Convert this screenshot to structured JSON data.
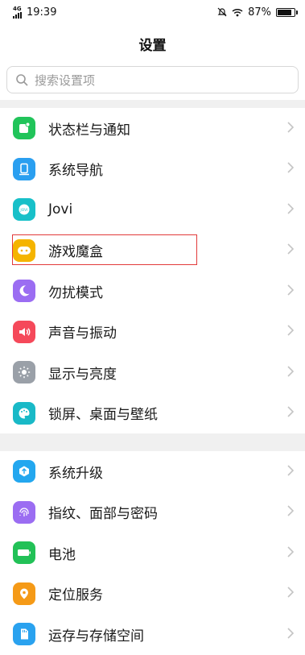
{
  "status_bar": {
    "network": "4G",
    "time": "19:39",
    "battery_percent": "87%",
    "battery_level": 0.87
  },
  "header": {
    "title": "设置"
  },
  "search": {
    "placeholder": "搜索设置项"
  },
  "groups": [
    {
      "items": [
        {
          "label": "状态栏与通知",
          "icon": "notification-icon",
          "color": "#21c45a"
        },
        {
          "label": "系统导航",
          "icon": "navigation-icon",
          "color": "#2a9ff0"
        },
        {
          "label": "Jovi",
          "icon": "jovi-icon",
          "color": "#18c0c9"
        },
        {
          "label": "游戏魔盒",
          "icon": "game-icon",
          "color": "#f5b400"
        },
        {
          "label": "勿扰模式",
          "icon": "moon-icon",
          "color": "#9b6df2"
        },
        {
          "label": "声音与振动",
          "icon": "sound-icon",
          "color": "#f5495a"
        },
        {
          "label": "显示与亮度",
          "icon": "brightness-icon",
          "color": "#9aa0a8"
        },
        {
          "label": "锁屏、桌面与壁纸",
          "icon": "palette-icon",
          "color": "#19b9c7"
        }
      ]
    },
    {
      "items": [
        {
          "label": "系统升级",
          "icon": "upgrade-icon",
          "color": "#23a7ef"
        },
        {
          "label": "指纹、面部与密码",
          "icon": "fingerprint-icon",
          "color": "#9b6df2"
        },
        {
          "label": "电池",
          "icon": "battery-icon",
          "color": "#22c157"
        },
        {
          "label": "定位服务",
          "icon": "location-icon",
          "color": "#f59a17"
        },
        {
          "label": "运存与存储空间",
          "icon": "storage-icon",
          "color": "#2aa2ef"
        }
      ]
    }
  ],
  "highlight_label": "游戏魔盒"
}
